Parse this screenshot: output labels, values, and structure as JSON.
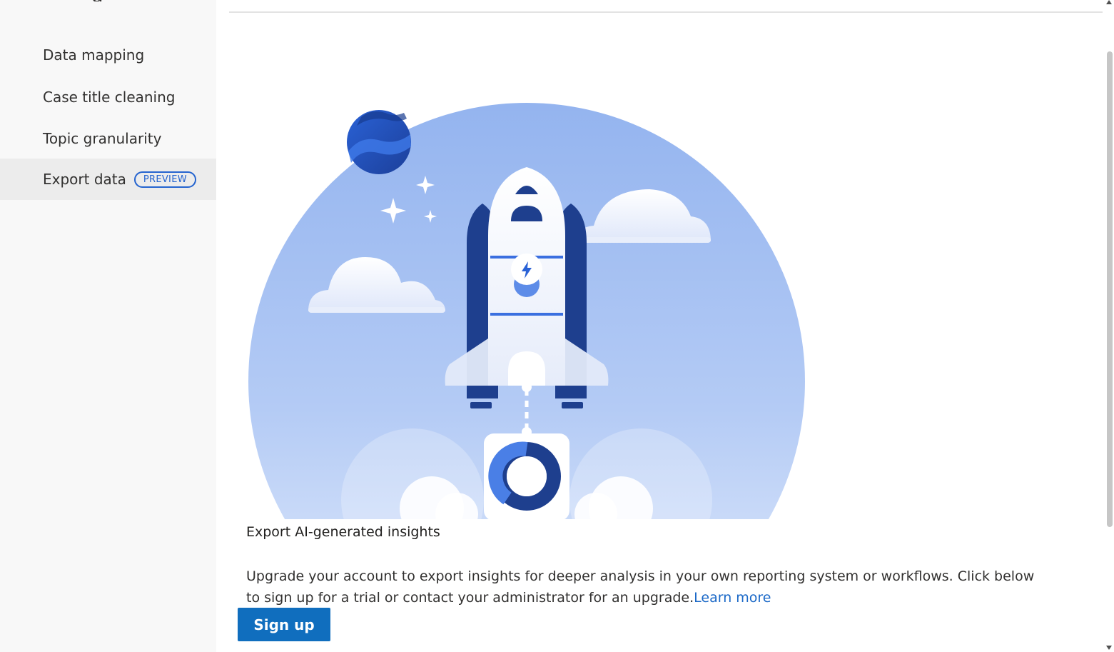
{
  "sidebar": {
    "title_fragment": "g",
    "items": [
      {
        "label": "Data mapping",
        "selected": false
      },
      {
        "label": "Case title cleaning",
        "selected": false
      },
      {
        "label": "Topic granularity",
        "selected": false
      },
      {
        "label": "Export data",
        "selected": true,
        "badge": "PREVIEW"
      }
    ]
  },
  "main": {
    "illustration": "rocket-launch-illustration",
    "heading": "Export AI-generated insights",
    "description": "Upgrade your account to export insights for deeper analysis in your own reporting system or workflows. Click below to sign up for a trial or contact your administrator for an upgrade.",
    "learn_more_label": "Learn more",
    "signup_label": "Sign up"
  },
  "colors": {
    "accent": "#106ebe",
    "link": "#1a68c7",
    "badge": "#2564cf",
    "sidebar_bg": "#f8f8f8",
    "selected_bg": "#ececec"
  }
}
